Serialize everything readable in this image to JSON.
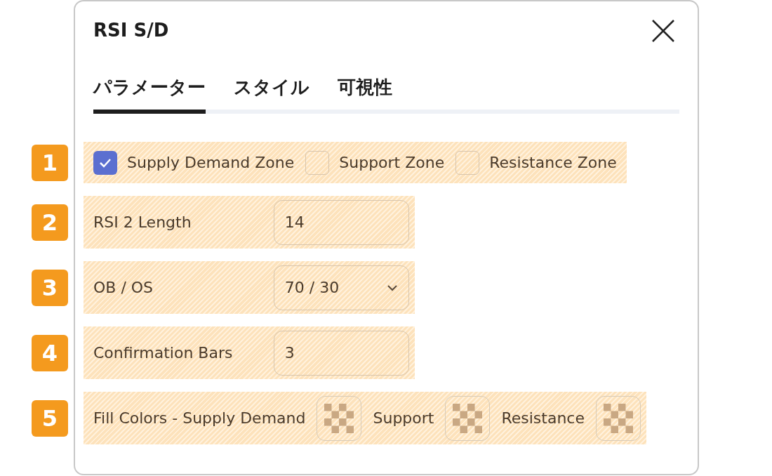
{
  "dialog": {
    "title": "RSI S/D"
  },
  "tabs": [
    {
      "label": "パラメーター",
      "selected": true
    },
    {
      "label": "スタイル",
      "selected": false
    },
    {
      "label": "可視性",
      "selected": false
    }
  ],
  "rows": [
    {
      "marker": "1",
      "kind": "checkboxes",
      "items": [
        {
          "label": "Supply Demand Zone",
          "checked": true
        },
        {
          "label": "Support Zone",
          "checked": false
        },
        {
          "label": "Resistance Zone",
          "checked": false
        }
      ]
    },
    {
      "marker": "2",
      "kind": "input",
      "label": "RSI 2 Length",
      "value": "14"
    },
    {
      "marker": "3",
      "kind": "select",
      "label": "OB / OS",
      "value": "70 / 30"
    },
    {
      "marker": "4",
      "kind": "input",
      "label": "Confirmation Bars",
      "value": "3"
    },
    {
      "marker": "5",
      "kind": "colors",
      "label": "Fill Colors - Supply Demand",
      "swatch_labels": [
        "Support",
        "Resistance"
      ]
    }
  ]
}
